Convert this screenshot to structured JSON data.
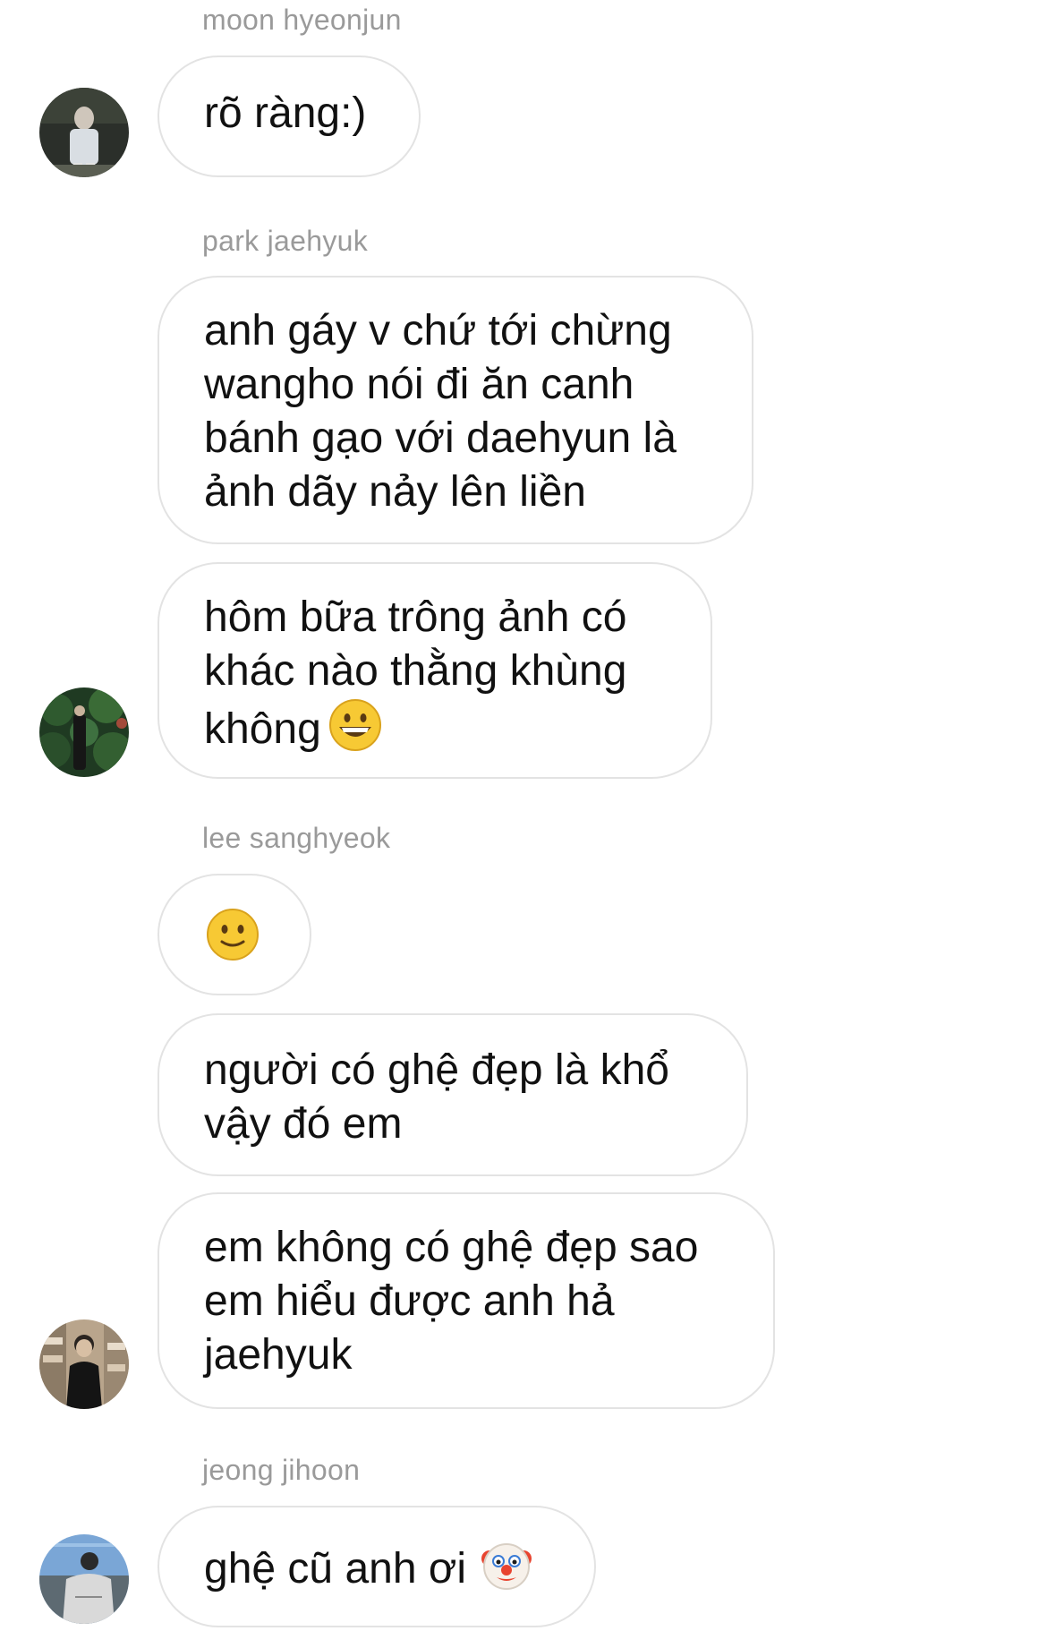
{
  "chat": {
    "messages": [
      {
        "sender": "moon hyeonjun",
        "text": "rõ ràng:)"
      },
      {
        "sender": "park jaehyuk",
        "text": "anh gáy v chứ tới chừng\nwangho nói đi ăn canh\nbánh gạo với daehyun là\nảnh dãy nảy lên liền"
      },
      {
        "text": "hôm bữa trông ảnh có\nkhác nào thằng khùng\nkhông",
        "emoji": "grinning-face-emoji"
      },
      {
        "sender": "lee sanghyeok",
        "emoji": "slightly-smiling-face-emoji"
      },
      {
        "text": "người có ghệ đẹp là khổ\nvậy đó em"
      },
      {
        "text": "em không có ghệ đẹp sao\nem hiểu được anh hả\njaehyuk"
      },
      {
        "sender": "jeong jihoon",
        "text": "ghệ cũ anh ơi",
        "emoji": "clown-face-emoji"
      }
    ]
  },
  "colors": {
    "sender_name": "#9a9a9a",
    "bubble_border": "#e3e3e3",
    "message_text": "#111111",
    "background": "#ffffff"
  }
}
